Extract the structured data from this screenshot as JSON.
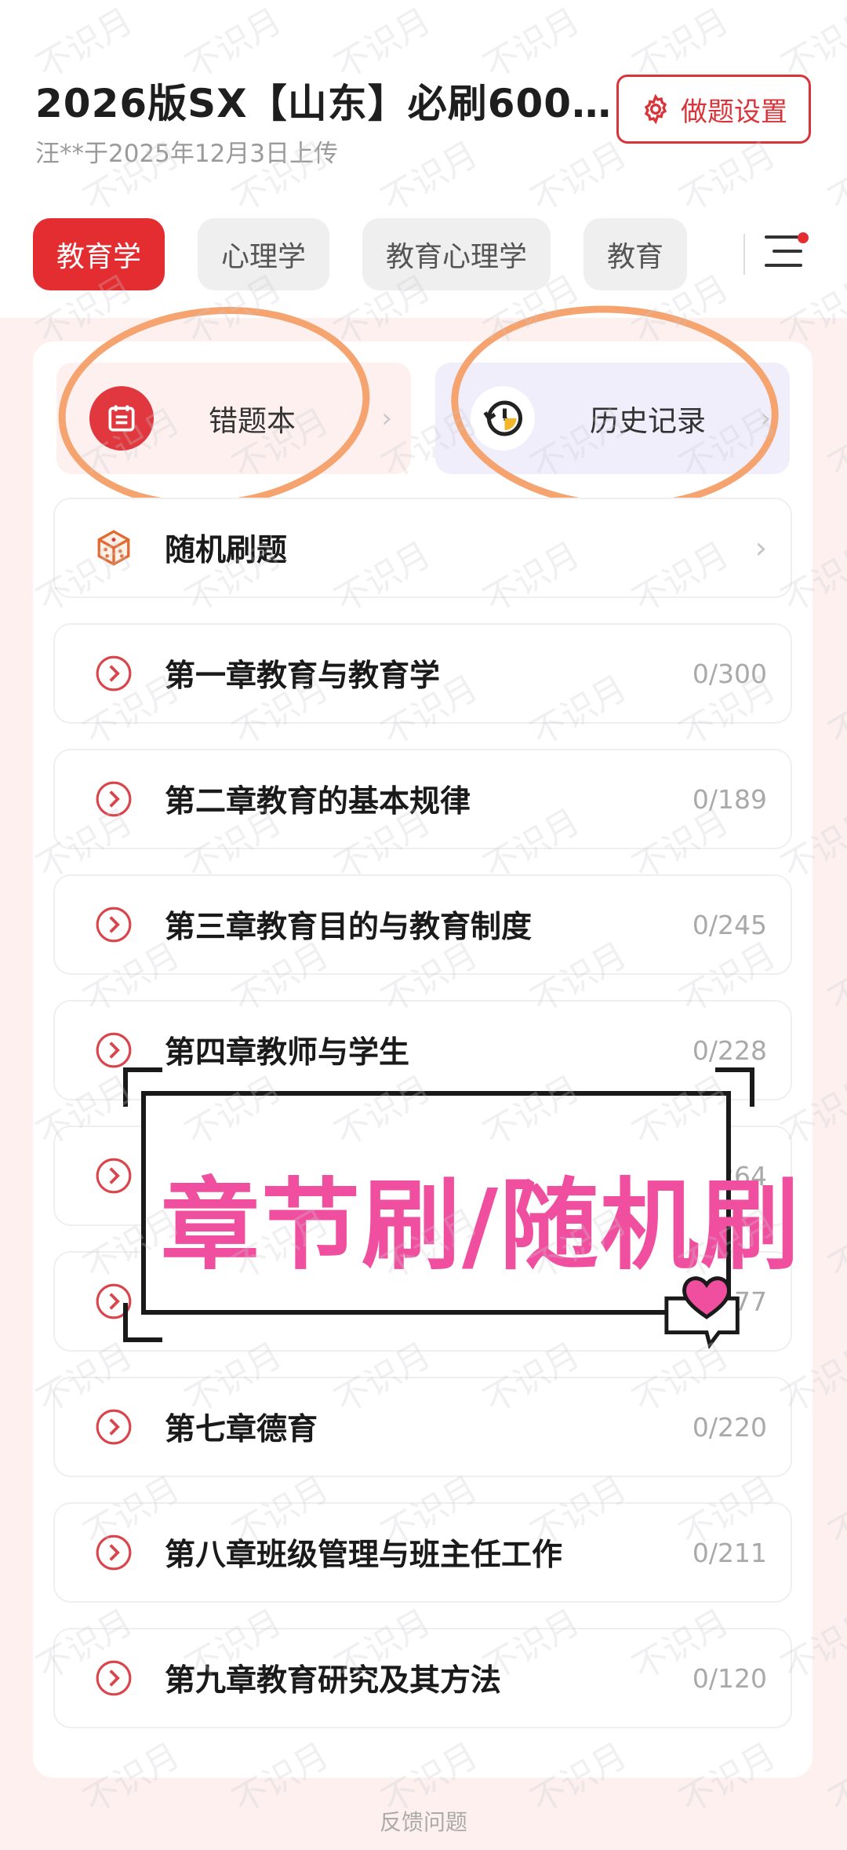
{
  "header": {
    "title": "2026版SX【山东】必刷6000…",
    "subtitle": "汪**于2025年12月3日上传",
    "settings_label": "做题设置"
  },
  "tabs": [
    {
      "label": "教育学",
      "active": true
    },
    {
      "label": "心理学",
      "active": false
    },
    {
      "label": "教育心理学",
      "active": false
    },
    {
      "label": "教育",
      "active": false
    }
  ],
  "quick_actions": {
    "wrong_book": "错题本",
    "history": "历史记录"
  },
  "random_practice": "随机刷题",
  "chapters": [
    {
      "title": "第一章教育与教育学",
      "count": "0/300"
    },
    {
      "title": "第二章教育的基本规律",
      "count": "0/189"
    },
    {
      "title": "第三章教育目的与教育制度",
      "count": "0/245"
    },
    {
      "title": "第四章教师与学生",
      "count": "0/228"
    },
    {
      "title": "",
      "count": "264"
    },
    {
      "title": "",
      "count": "77"
    },
    {
      "title": "第七章德育",
      "count": "0/220"
    },
    {
      "title": "第八章班级管理与班主任工作",
      "count": "0/211"
    },
    {
      "title": "第九章教育研究及其方法",
      "count": "0/120"
    }
  ],
  "overlay_banner": "章节刷/随机刷",
  "watermark_text": "不识月",
  "footer": "反馈问题",
  "colors": {
    "accent": "#e32d30",
    "annotation_ring": "#f5a36f",
    "banner_text": "#f04fa0"
  }
}
